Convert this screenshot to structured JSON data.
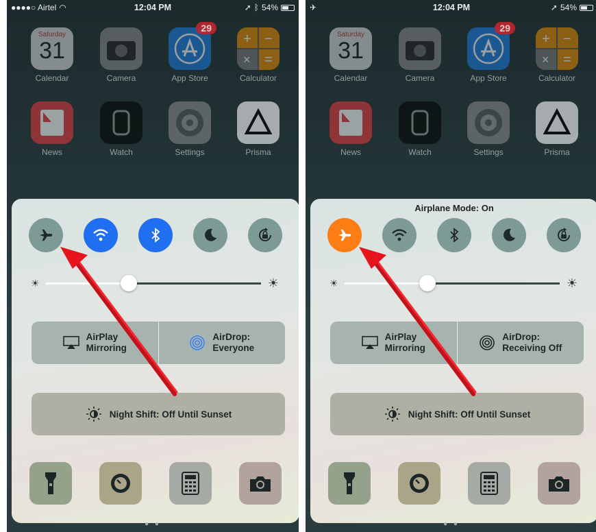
{
  "left": {
    "status": {
      "carrier": "●●●●○ Airtel",
      "time": "12:04 PM",
      "battery": "54%"
    },
    "apps": [
      {
        "label": "Calendar",
        "day": "Saturday",
        "date": "31"
      },
      {
        "label": "Camera"
      },
      {
        "label": "App Store",
        "badge": "29"
      },
      {
        "label": "Calculator"
      },
      {
        "label": "News"
      },
      {
        "label": "Watch"
      },
      {
        "label": "Settings"
      },
      {
        "label": "Prisma"
      }
    ],
    "control_center": {
      "title": "",
      "airplay": [
        "AirPlay",
        "Mirroring"
      ],
      "airdrop": [
        "AirDrop:",
        "Everyone"
      ],
      "night_shift": "Night Shift: Off Until Sunset",
      "brightness": 0.46
    }
  },
  "right": {
    "status": {
      "carrier": "",
      "time": "12:04 PM",
      "battery": "54%"
    },
    "apps": [
      {
        "label": "Calendar",
        "day": "Saturday",
        "date": "31"
      },
      {
        "label": "Camera"
      },
      {
        "label": "App Store",
        "badge": "29"
      },
      {
        "label": "Calculator"
      },
      {
        "label": "News"
      },
      {
        "label": "Watch"
      },
      {
        "label": "Settings"
      },
      {
        "label": "Prisma"
      }
    ],
    "control_center": {
      "title": "Airplane Mode: On",
      "airplay": [
        "AirPlay",
        "Mirroring"
      ],
      "airdrop": [
        "AirDrop:",
        "Receiving Off"
      ],
      "night_shift": "Night Shift: Off Until Sunset",
      "brightness": 0.46
    }
  },
  "page_dots": "● ●",
  "colors": {
    "blue": "#1f6ff0",
    "orange": "#fb7d14",
    "arrow": "#e8141c"
  }
}
